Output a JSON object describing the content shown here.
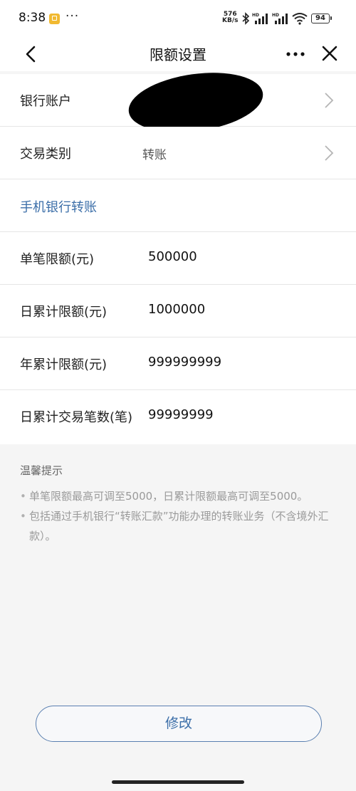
{
  "status_bar": {
    "time": "8:38",
    "more": "···",
    "net_speed_value": "576",
    "net_speed_unit": "KB/s",
    "battery": "94",
    "icons": [
      "app-notification-icon",
      "bluetooth-icon",
      "signal-hd-icon",
      "signal-hd-icon",
      "wifi-icon",
      "battery-icon"
    ]
  },
  "nav": {
    "title": "限额设置",
    "more": "•••",
    "icons": [
      "back-arrow-icon",
      "more-icon",
      "close-icon"
    ]
  },
  "rows": {
    "account_label": "银行账户",
    "type_label": "交易类别",
    "type_value": "转账",
    "section_title": "手机银行转账",
    "single_label": "单笔限额(元)",
    "single_value": "500000",
    "daily_label": "日累计限额(元)",
    "daily_value": "1000000",
    "yearly_label": "年累计限额(元)",
    "yearly_value": "999999999",
    "count_label": "日累计交易笔数(笔)",
    "count_value": "99999999"
  },
  "tips": {
    "title": "温馨提示",
    "items": [
      "单笔限额最高可调至5000，日累计限额最高可调至5000。",
      "包括通过手机银行“转账汇款”功能办理的转账业务（不含境外汇款）。"
    ]
  },
  "actions": {
    "modify_label": "修改"
  },
  "colors": {
    "accent": "#3b6ea8",
    "background": "#f5f5f5",
    "card": "#ffffff"
  }
}
